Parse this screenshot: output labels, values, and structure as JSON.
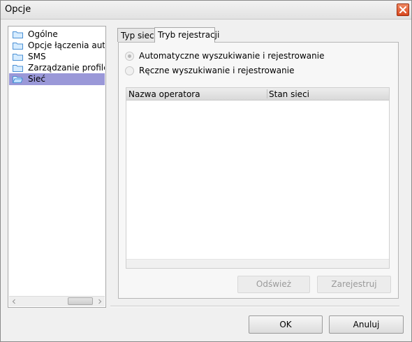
{
  "window": {
    "title": "Opcje"
  },
  "tree": {
    "items": [
      {
        "label": "Ogólne"
      },
      {
        "label": "Opcje łączenia autom"
      },
      {
        "label": "SMS"
      },
      {
        "label": "Zarządzanie profilem"
      },
      {
        "label": "Sieć"
      }
    ],
    "selected": "Sieć",
    "icon": "folder-icon"
  },
  "tabs": [
    {
      "label": "Typ sieci"
    },
    {
      "label": "Tryb rejestracji"
    }
  ],
  "active_tab": "Tryb rejestracji",
  "registration": {
    "auto_label": "Automatyczne wyszukiwanie i rejestrowanie",
    "manual_label": "Ręczne wyszukiwanie i rejestrowanie",
    "selected": "auto"
  },
  "operators": {
    "columns": [
      "Nazwa operatora",
      "Stan sieci"
    ],
    "rows": []
  },
  "buttons": {
    "refresh": "Odśwież",
    "register": "Zarejestruj",
    "ok": "OK",
    "cancel": "Anuluj"
  },
  "colors": {
    "selection": "#9a98d8",
    "close_button": "#d9471e"
  }
}
